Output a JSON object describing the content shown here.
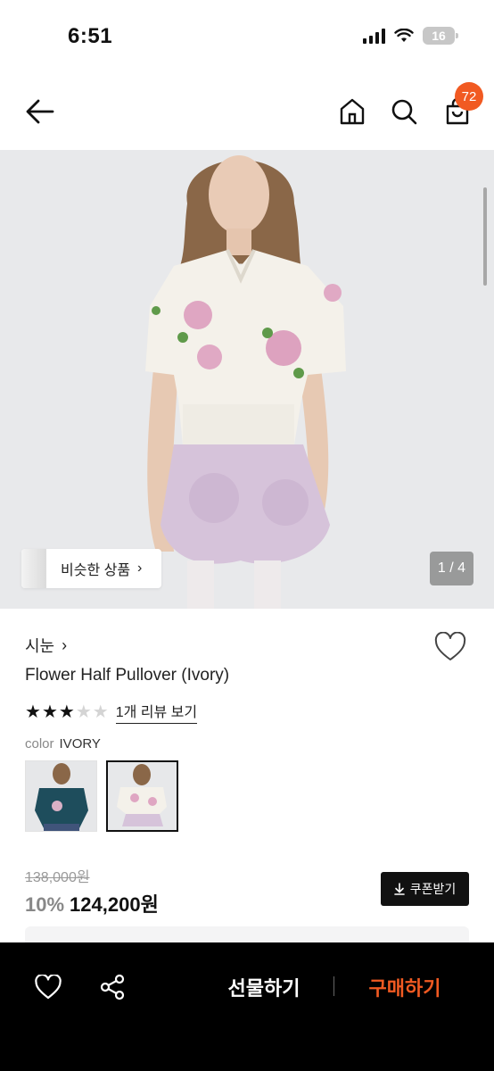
{
  "status_bar": {
    "time": "6:51",
    "battery": "16"
  },
  "header": {
    "cart_count": "72"
  },
  "gallery": {
    "similar_label": "비슷한 상품",
    "similar_arrow": "›",
    "page_indicator": "1 / 4"
  },
  "product": {
    "brand": "시눈",
    "brand_arrow": "›",
    "name": "Flower Half Pullover (Ivory)",
    "rating": 3,
    "rating_max": 5,
    "review_link": "1개 리뷰 보기",
    "color_label": "color",
    "color_value": "IVORY",
    "original_price": "138,000원",
    "discount": "10%",
    "price": "124,200원",
    "coupon_label": "쿠폰받기"
  },
  "bottom_bar": {
    "gift_label": "선물하기",
    "buy_label": "구매하기"
  },
  "colors": {
    "accent": "#f15a22",
    "bottom_bar_bg": "#000000"
  },
  "icons": [
    "back-arrow-icon",
    "home-icon",
    "search-icon",
    "shopping-bag-icon",
    "heart-icon",
    "share-icon",
    "download-icon",
    "star-icon"
  ]
}
